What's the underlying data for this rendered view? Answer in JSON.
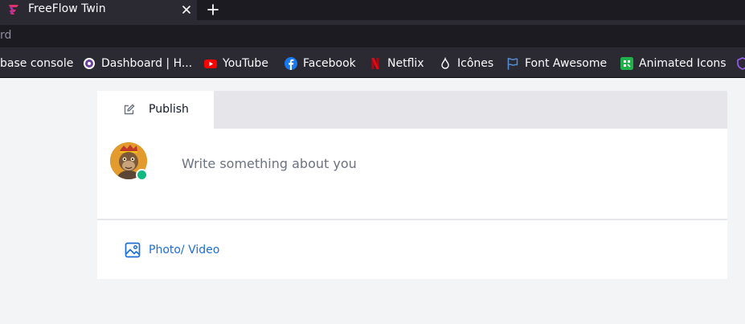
{
  "browser": {
    "tab": {
      "title": "FreeFlow Twin",
      "favicon": "freeflow-logo-icon",
      "close_icon": "close-icon"
    },
    "new_tab_icon": "plus-icon",
    "url_partial": "rd",
    "bookmarks": [
      {
        "label": "base console",
        "icon": ""
      },
      {
        "label": "Dashboard | H...",
        "icon": "dashboard-icon"
      },
      {
        "label": "YouTube",
        "icon": "youtube-icon"
      },
      {
        "label": "Facebook",
        "icon": "facebook-icon"
      },
      {
        "label": "Netflix",
        "icon": "netflix-icon"
      },
      {
        "label": "Icônes",
        "icon": "iconify-icon"
      },
      {
        "label": "Font Awesome",
        "icon": "flag-icon"
      },
      {
        "label": "Animated Icons",
        "icon": "animated-icons-icon"
      }
    ]
  },
  "post_composer": {
    "tabs": [
      {
        "label": "Publish",
        "icon": "edit-icon",
        "active": true
      }
    ],
    "placeholder": "Write something about you",
    "avatar": "user-avatar",
    "status": "online",
    "actions": [
      {
        "label": "Photo/ Video",
        "icon": "image-icon"
      }
    ]
  },
  "colors": {
    "chrome_dark": "#1c1b22",
    "chrome_bar": "#2b2a33",
    "page_bg": "#f3f4f6",
    "accent_link": "#1d6fd8",
    "online": "#10b981"
  }
}
